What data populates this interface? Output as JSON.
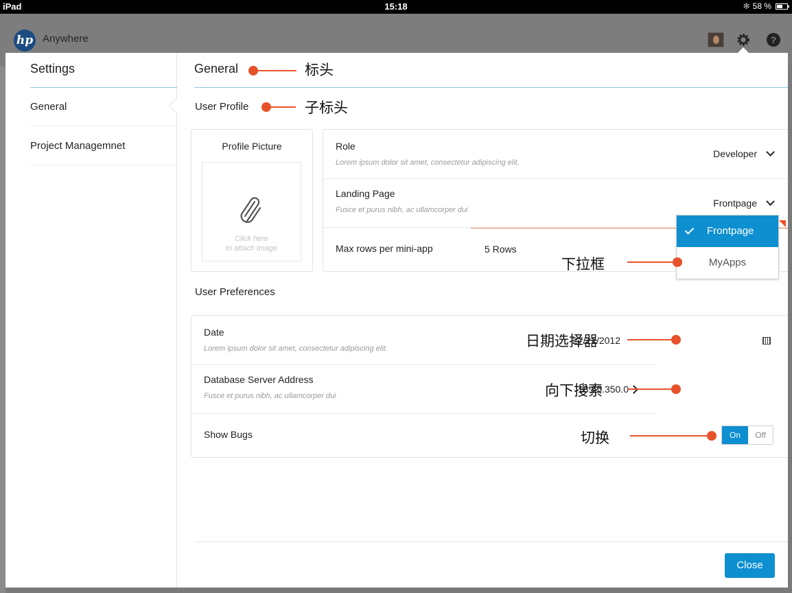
{
  "status_bar": {
    "device": "iPad",
    "time": "15:18",
    "bluetooth": "✻",
    "battery": "58 %"
  },
  "app": {
    "logo": "hp",
    "name": "Anywhere"
  },
  "top_icons": [
    "avatar",
    "gear-icon",
    "help-icon"
  ],
  "help_glyph": "?",
  "sidebar": {
    "title": "Settings",
    "items": [
      {
        "label": "General",
        "active": true
      },
      {
        "label": "Project Managemnet",
        "active": false
      }
    ]
  },
  "main": {
    "section_title": "General",
    "profile_heading": "User Profile",
    "profile_picture": {
      "title": "Profile Picture",
      "hint_line1": "Click here",
      "hint_line2": "to attach image"
    },
    "settings": [
      {
        "label": "Role",
        "desc": "Lorem ipsum dolor sit amet, consectetur adipiscing elit.",
        "value": "Developer"
      },
      {
        "label": "Landing Page",
        "desc": "Fusce et purus nibh, ac ullamcorper dui",
        "value": "Frontpage"
      },
      {
        "label": "Max rows per mini-app",
        "value": "5 Rows"
      }
    ],
    "dropdown": {
      "options": [
        "Frontpage",
        "MyApps"
      ],
      "selected": "Frontpage"
    },
    "preferences_heading": "User Preferences",
    "preferences": [
      {
        "label": "Date",
        "desc": "Lorem ipsum dolor sit amet, consectetur adipiscing elit.",
        "value": "27/12/2012"
      },
      {
        "label": "Database Server Address",
        "desc": "Fusce et purus nibh, ac ullamcorper dui",
        "value": "18.55.350.0"
      },
      {
        "label": "Show Bugs",
        "toggle_on": "On",
        "toggle_off": "Off",
        "state": "On"
      }
    ],
    "close_label": "Close"
  },
  "annotations": {
    "header": "标头",
    "subheader": "子标头",
    "dropdown": "下拉框",
    "date_picker": "日期选择器",
    "drilldown": "向下搜索",
    "toggle": "切换"
  },
  "colors": {
    "accent": "#0d8fd0",
    "annotation": "#e8522a",
    "divider_blue": "#8fc4e4"
  }
}
